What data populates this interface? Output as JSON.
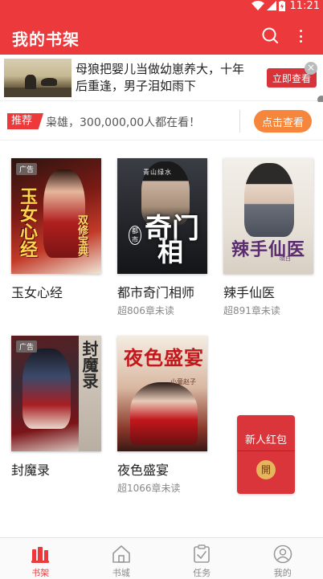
{
  "status": {
    "time": "11:21"
  },
  "header": {
    "title": "我的书架"
  },
  "ad": {
    "text": "母狼把婴儿当做幼崽养大，十年后重逢，男子泪如雨下",
    "cta": "立即查看",
    "close": "×"
  },
  "recommend": {
    "tag": "推荐",
    "text": "枭雄，300,000,00人都在看！",
    "button": "点击查看"
  },
  "books": [
    {
      "title": "玉女心经",
      "sub": "",
      "ad_badge": "广告",
      "cover_title": "玉女心经",
      "cover_sub": "双修宝典"
    },
    {
      "title": "都市奇门相师",
      "sub": "超806章未读",
      "ad_badge": "",
      "cover_small": "青山绿水",
      "cover_t1": "奇门",
      "cover_t2": "相师",
      "cover_seal": "都市"
    },
    {
      "title": "辣手仙医",
      "sub": "超891章未读",
      "ad_badge": "",
      "cover_title": "辣手仙医",
      "cover_sub": "晓白"
    },
    {
      "title": "封魔录",
      "sub": "",
      "ad_badge": "广告",
      "cover_title": "封魔录"
    },
    {
      "title": "夜色盛宴",
      "sub": "超1066章未读",
      "ad_badge": "",
      "cover_title": "夜色盛宴",
      "cover_sub": "小童赵子"
    }
  ],
  "envelope": {
    "text": "新人红包",
    "button": "開"
  },
  "nav": [
    {
      "label": "书架",
      "icon": "bookshelf-icon",
      "active": true
    },
    {
      "label": "书城",
      "icon": "home-icon",
      "active": false
    },
    {
      "label": "任务",
      "icon": "task-icon",
      "active": false
    },
    {
      "label": "我的",
      "icon": "profile-icon",
      "active": false
    }
  ],
  "colors": {
    "primary": "#ec3a3c",
    "cta_orange": "#f5863b",
    "envelope": "#d9353a"
  }
}
